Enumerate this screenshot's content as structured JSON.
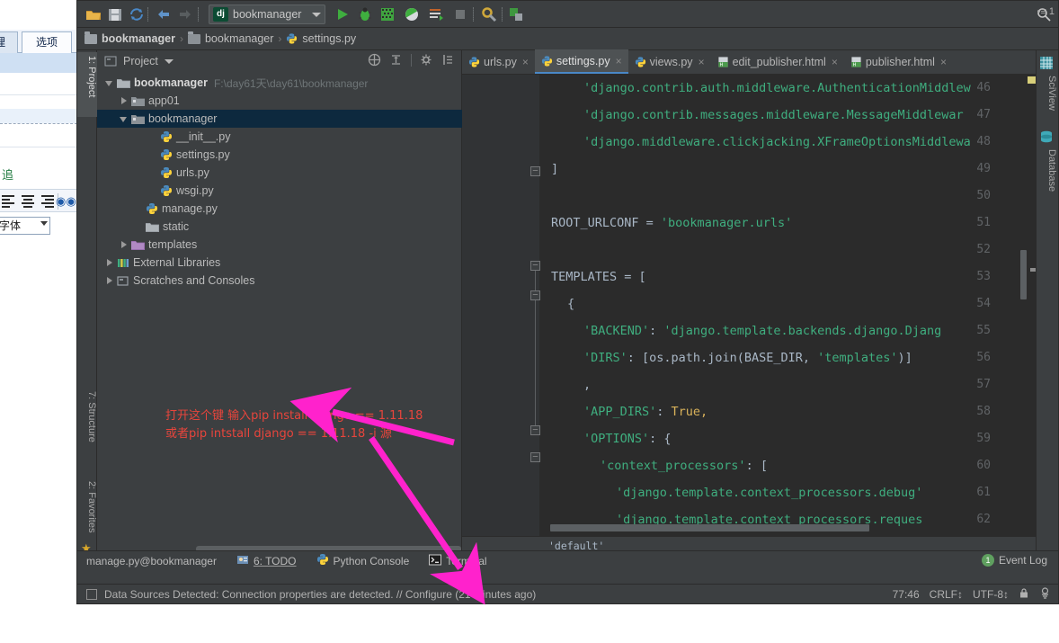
{
  "background_window": {
    "tabs": [
      "理",
      "选项"
    ],
    "green_text": "追",
    "font_selector_value": "字体",
    "find_icon": "binoculars-icon"
  },
  "toolbar": {
    "icons": [
      "open-folder-icon",
      "save-all-icon",
      "sync-icon",
      "back-arrow-icon",
      "forward-arrow-icon"
    ],
    "run_config": {
      "badge": "dj",
      "name": "bookmanager"
    },
    "action_icons": [
      "run-icon",
      "debug-icon",
      "coverage-icon",
      "profile-icon",
      "run-with-console-icon",
      "stop-icon",
      "settings-icon",
      "project-structure-icon"
    ],
    "search_icon": "search-icon"
  },
  "breadcrumb": [
    {
      "label": "bookmanager",
      "icon": "folder-icon"
    },
    {
      "label": "bookmanager",
      "icon": "module-icon"
    },
    {
      "label": "settings.py",
      "icon": "python-file-icon"
    }
  ],
  "left_tool_strip": [
    {
      "label": "1: Project",
      "active": true
    },
    {
      "label": "7: Structure",
      "active": false
    },
    {
      "label": "2: Favorites",
      "active": false
    }
  ],
  "right_tool_strip": [
    {
      "label": "SciView"
    },
    {
      "label": "Database"
    }
  ],
  "project_panel": {
    "title": "Project",
    "tools": [
      "collapse-all-icon",
      "expand-icon",
      "settings-gear-icon",
      "hide-icon"
    ],
    "tree": [
      {
        "label": "bookmanager",
        "path": "F:\\day61天\\day61\\bookmanager",
        "indent": 0,
        "twisty": "down",
        "icon": "folder-icon",
        "bold": true,
        "selected": false
      },
      {
        "label": "app01",
        "indent": 1,
        "twisty": "right",
        "icon": "module-icon",
        "bold": false,
        "selected": false
      },
      {
        "label": "bookmanager",
        "indent": 1,
        "twisty": "down",
        "icon": "module-icon",
        "bold": false,
        "selected": true
      },
      {
        "label": "__init__.py",
        "indent": 3,
        "twisty": "none",
        "icon": "python-file-icon",
        "bold": false,
        "selected": false
      },
      {
        "label": "settings.py",
        "indent": 3,
        "twisty": "none",
        "icon": "python-file-icon",
        "bold": false,
        "selected": false
      },
      {
        "label": "urls.py",
        "indent": 3,
        "twisty": "none",
        "icon": "python-file-icon",
        "bold": false,
        "selected": false
      },
      {
        "label": "wsgi.py",
        "indent": 3,
        "twisty": "none",
        "icon": "python-file-icon",
        "bold": false,
        "selected": false
      },
      {
        "label": "manage.py",
        "indent": 2,
        "twisty": "none",
        "icon": "python-file-icon",
        "bold": false,
        "selected": false
      },
      {
        "label": "static",
        "indent": 2,
        "twisty": "none",
        "icon": "folder-icon",
        "bold": false,
        "selected": false
      },
      {
        "label": "templates",
        "indent": 1,
        "twisty": "right",
        "icon": "templates-folder-icon",
        "bold": false,
        "selected": false
      },
      {
        "label": "External Libraries",
        "indent": 0,
        "twisty": "right",
        "icon": "libraries-icon",
        "bold": false,
        "selected": false
      },
      {
        "label": "Scratches and Consoles",
        "indent": 0,
        "twisty": "right",
        "icon": "scratches-icon",
        "bold": false,
        "selected": false
      }
    ]
  },
  "editor_tabs": [
    {
      "label": "urls.py",
      "icon": "python-file-icon",
      "active": false
    },
    {
      "label": "settings.py",
      "icon": "python-file-icon",
      "active": true
    },
    {
      "label": "views.py",
      "icon": "python-file-icon",
      "active": false
    },
    {
      "label": "edit_publisher.html",
      "icon": "html-file-icon",
      "active": false
    },
    {
      "label": "publisher.html",
      "icon": "html-file-icon",
      "active": false
    }
  ],
  "editor": {
    "close_glyph": "×",
    "tab_overflow": "1",
    "bottom_text": "'default'",
    "lines": [
      {
        "no": "46",
        "indent": 5,
        "tokens": [
          {
            "t": "'django.contrib.auth.middleware.AuthenticationMiddlew",
            "c": "s-str2"
          }
        ]
      },
      {
        "no": "47",
        "indent": 5,
        "tokens": [
          {
            "t": "'django.contrib.messages.middleware.MessageMiddlewar",
            "c": "s-str2"
          }
        ]
      },
      {
        "no": "48",
        "indent": 5,
        "tokens": [
          {
            "t": "'django.middleware.clickjacking.XFrameOptionsMiddlewa",
            "c": "s-str2"
          }
        ]
      },
      {
        "no": "49",
        "indent": 1,
        "tokens": [
          {
            "t": "]",
            "c": "s-txt"
          }
        ]
      },
      {
        "no": "50",
        "indent": 0,
        "tokens": []
      },
      {
        "no": "51",
        "indent": 1,
        "tokens": [
          {
            "t": "ROOT_URLCONF = ",
            "c": "s-txt"
          },
          {
            "t": "'bookmanager.urls'",
            "c": "s-str2"
          }
        ]
      },
      {
        "no": "52",
        "indent": 0,
        "tokens": []
      },
      {
        "no": "53",
        "indent": 1,
        "tokens": [
          {
            "t": "TEMPLATES = [",
            "c": "s-txt"
          }
        ]
      },
      {
        "no": "54",
        "indent": 3,
        "tokens": [
          {
            "t": "{",
            "c": "s-txt"
          }
        ]
      },
      {
        "no": "55",
        "indent": 5,
        "tokens": [
          {
            "t": "'BACKEND'",
            "c": "s-str2"
          },
          {
            "t": ": ",
            "c": "s-txt"
          },
          {
            "t": "'django.template.backends.django.Djang",
            "c": "s-str2"
          }
        ]
      },
      {
        "no": "56",
        "indent": 5,
        "tokens": [
          {
            "t": "'DIRS'",
            "c": "s-str2"
          },
          {
            "t": ": [os.path.join(BASE_DIR, ",
            "c": "s-txt"
          },
          {
            "t": "'templates'",
            "c": "s-str2"
          },
          {
            "t": ")]",
            "c": "s-txt"
          }
        ]
      },
      {
        "no": "57",
        "indent": 5,
        "tokens": [
          {
            "t": ",",
            "c": "s-txt"
          }
        ]
      },
      {
        "no": "58",
        "indent": 5,
        "tokens": [
          {
            "t": "'APP_DIRS'",
            "c": "s-str2"
          },
          {
            "t": ": ",
            "c": "s-txt"
          },
          {
            "t": "True,",
            "c": "s-const"
          }
        ]
      },
      {
        "no": "59",
        "indent": 5,
        "tokens": [
          {
            "t": "'OPTIONS'",
            "c": "s-str2"
          },
          {
            "t": ": {",
            "c": "s-txt"
          }
        ]
      },
      {
        "no": "60",
        "indent": 7,
        "tokens": [
          {
            "t": "'context_processors'",
            "c": "s-str2"
          },
          {
            "t": ": [",
            "c": "s-txt"
          }
        ]
      },
      {
        "no": "61",
        "indent": 9,
        "tokens": [
          {
            "t": "'django.template.context_processors.debug'",
            "c": "s-str2"
          }
        ]
      },
      {
        "no": "62",
        "indent": 9,
        "tokens": [
          {
            "t": "'django.template.context_processors.reques",
            "c": "s-str2"
          }
        ]
      }
    ]
  },
  "annotation": {
    "line1": "打开这个键 输入pip install django == 1.11.18",
    "line2": "或者pip intstall django == 1.11.18 -i 源",
    "color": "#e8453c",
    "arrow_color": "#ff22cc"
  },
  "bottom_bar": {
    "buttons": [
      {
        "label": "manage.py@bookmanager",
        "icon": "none"
      },
      {
        "label": "6: TODO",
        "icon": "todo-icon"
      },
      {
        "label": "Python Console",
        "icon": "python-icon"
      },
      {
        "label": "Terminal",
        "icon": "terminal-icon"
      }
    ],
    "event_log": {
      "label": "Event Log",
      "count": "1"
    }
  },
  "status_bar": {
    "icon": "data-source-icon",
    "message": "Data Sources Detected: Connection properties are detected. // Configure (21 minutes ago)",
    "caret": "77:46",
    "line_separator": "CRLF",
    "encoding": "UTF-8",
    "lock_icon": "lock-icon",
    "inspection_icon": "inspection-icon"
  }
}
